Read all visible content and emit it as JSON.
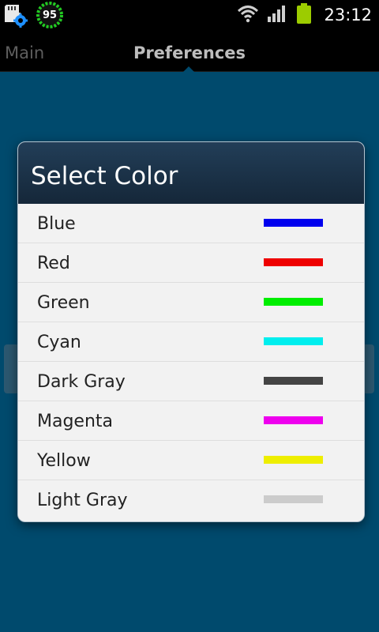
{
  "status_bar": {
    "badge_value": "95",
    "time": "23:12",
    "icons": [
      "sdcard-settings-icon",
      "battery-gauge-icon",
      "wifi-icon",
      "signal-icon",
      "battery-icon"
    ]
  },
  "tabs": {
    "main_label": "Main",
    "preferences_label": "Preferences"
  },
  "dialog": {
    "title": "Select Color",
    "options": [
      {
        "label": "Blue",
        "color": "#0000ee"
      },
      {
        "label": "Red",
        "color": "#ee0000"
      },
      {
        "label": "Green",
        "color": "#00ee00"
      },
      {
        "label": "Cyan",
        "color": "#00eeee"
      },
      {
        "label": "Dark Gray",
        "color": "#444444"
      },
      {
        "label": "Magenta",
        "color": "#ee00ee"
      },
      {
        "label": "Yellow",
        "color": "#eeee00"
      },
      {
        "label": "Light Gray",
        "color": "#cccccc"
      }
    ]
  },
  "colors": {
    "background": "#004a6d",
    "dialog_header": "#1b3347",
    "battery": "#9ccc00"
  }
}
